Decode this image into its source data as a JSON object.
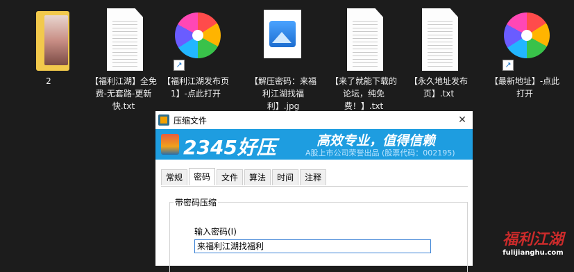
{
  "files": [
    {
      "label": "2"
    },
    {
      "label": "【福利江湖】全免费-无套路-更新快.txt"
    },
    {
      "label": "【福利江湖发布页1】-点此打开"
    },
    {
      "label": "【解压密码：来福利江湖找福利】.jpg"
    },
    {
      "label": "【来了就能下载的论坛，纯免费！】.txt"
    },
    {
      "label": "【永久地址发布页】.txt"
    },
    {
      "label": "【最新地址】-点此打开"
    }
  ],
  "dialog": {
    "title": "压缩文件",
    "close": "✕",
    "banner": {
      "logo": "2345好压",
      "slogan": "高效专业，值得信赖",
      "subline": "A股上市公司荣誉出品 (股票代码：002195)"
    },
    "tabs": [
      "常规",
      "密码",
      "文件",
      "算法",
      "时间",
      "注释"
    ],
    "group_title": "带密码压缩",
    "password_label": "输入密码(I)",
    "password_value": "来福利江湖找福利"
  },
  "watermark": {
    "main": "福利江湖",
    "sub": "fulijianghu.com"
  },
  "colors": {
    "desktop_bg": "#1c1c1c",
    "banner_bg": "#1e9de0",
    "input_border": "#3b82d6"
  }
}
